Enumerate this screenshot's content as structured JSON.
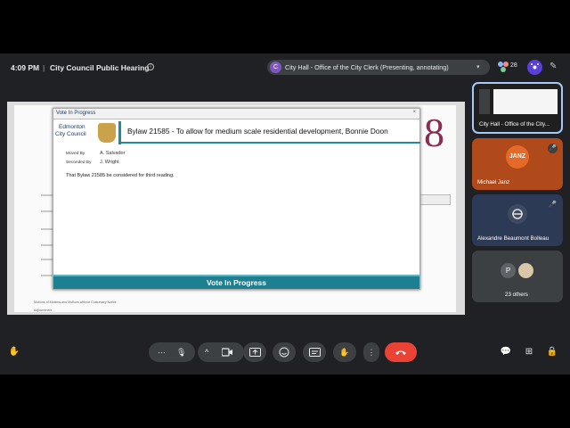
{
  "meeting": {
    "time": "4:09 PM",
    "separator": "|",
    "title": "City Council Public Hearing",
    "presenter_initial": "C",
    "presenter_label": "City Hall - Office of the City Clerk (Presenting, annotating)",
    "participant_count": "28"
  },
  "dialog": {
    "header_title": "Vote In Progress",
    "close_label": "×",
    "org_line1": "Edmonton",
    "org_line2": "City Council",
    "bylaw_title": "Bylaw 21585 - To allow for medium scale residential development, Bonnie Doon",
    "moved_by_label": "Moved By",
    "moved_by_value": "A. Salvador",
    "seconded_by_label": "Seconded By",
    "seconded_by_value": "J. Wright",
    "motion_text": "That Bylaw 21585 be considered for third reading.",
    "banner_text": "Vote In Progress"
  },
  "document": {
    "big_digit": "8",
    "footer_lines": [
      "Motions of Motions and Motions without Customary Notice",
      "Adjournment"
    ]
  },
  "tiles": [
    {
      "name": "City Hall - Office of the City...",
      "color": "#ffffff"
    },
    {
      "name": "Michael Janz",
      "badge": "JANZ",
      "color": "#c8571d"
    },
    {
      "name": "Alexandre Beaumont Bolleau",
      "color": "#2c4f8a"
    },
    {
      "name": "23 others",
      "initial": "P",
      "color": "#3c4043"
    }
  ],
  "controls": {
    "more_label": "⋯",
    "mic_icon": "mic-icon",
    "camera_icon": "camera-icon",
    "present_icon": "present-icon",
    "emoji_icon": "emoji-icon",
    "captions_icon": "captions-icon",
    "hand_icon": "raise-hand-icon",
    "options_icon": "more-options-icon",
    "end_call_icon": "end-call-icon"
  },
  "colors": {
    "meet_bg": "#202124",
    "accent_teal": "#1e7f91",
    "end_call": "#ea4335"
  }
}
